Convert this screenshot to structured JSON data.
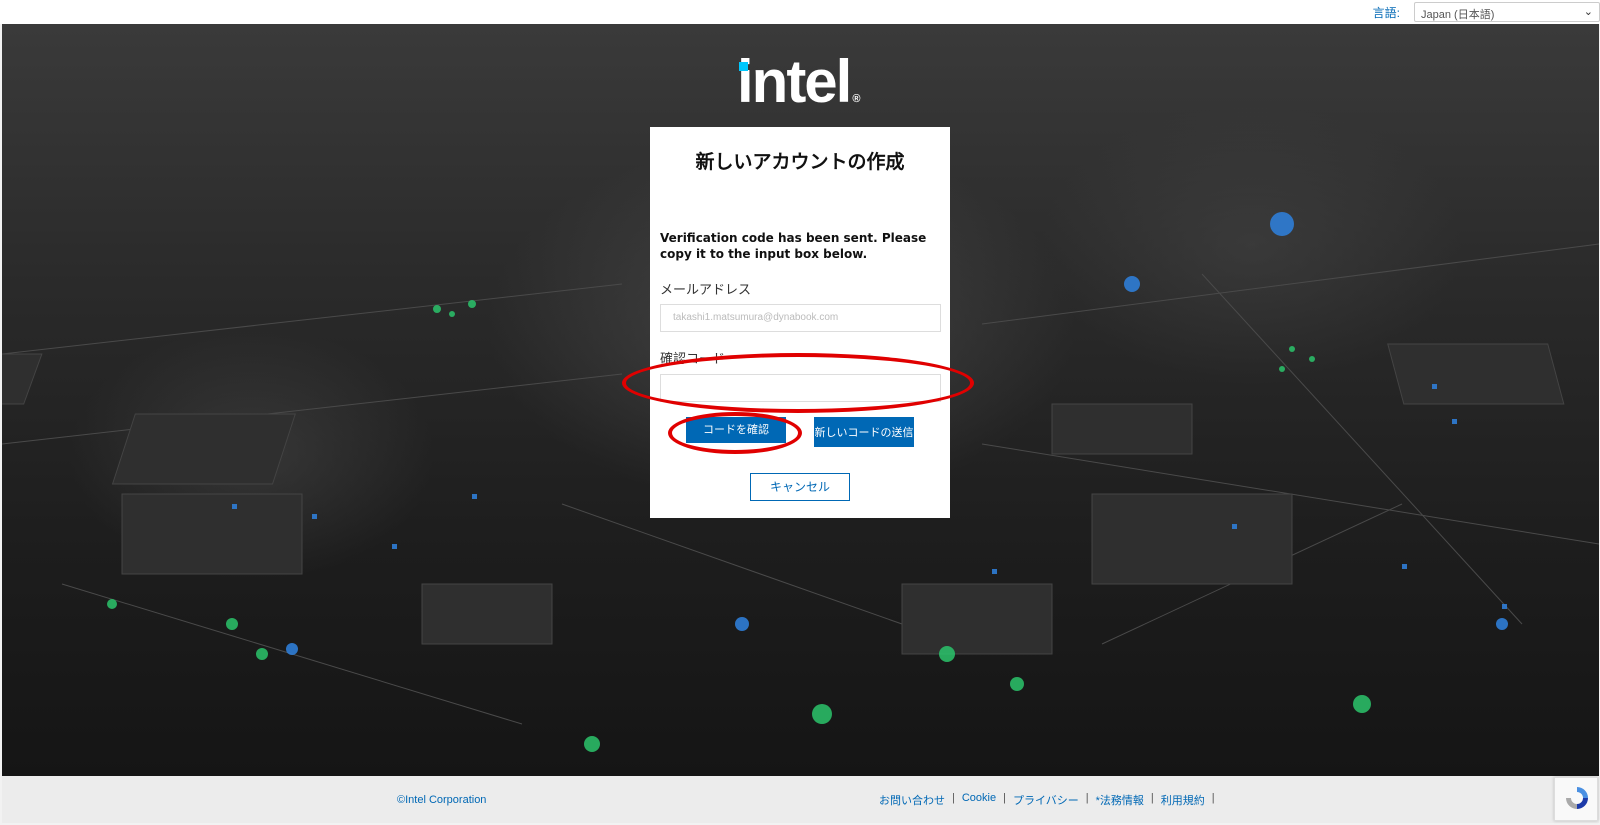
{
  "topbar": {
    "language_label": "言語:",
    "language_selected": "Japan (日本語)"
  },
  "logo": {
    "text": "intel",
    "reg": "®"
  },
  "card": {
    "title": "新しいアカウントの作成",
    "message": "Verification code has been sent. Please copy it to the input box below.",
    "email_label": "メールアドレス",
    "email_value": "takashi1.matsumura@dynabook.com",
    "code_label": "確認コード",
    "verify_button": "コードを確認",
    "resend_button": "新しいコードの送信",
    "cancel_button": "キャンセル"
  },
  "footer": {
    "copyright": "©Intel Corporation",
    "links": [
      "お問い合わせ",
      "Cookie",
      "プライバシー",
      "*法務情報",
      "利用規約"
    ]
  },
  "colors": {
    "brand_blue": "#0068b5",
    "annotation_red": "#e00000"
  }
}
